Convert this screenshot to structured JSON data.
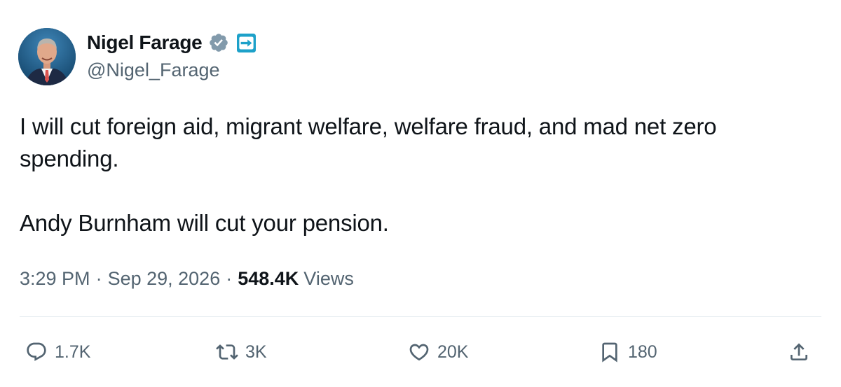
{
  "author": {
    "name": "Nigel Farage",
    "handle": "@Nigel_Farage",
    "verified_icon": "verified-badge-icon",
    "affiliation_icon": "affiliation-badge-icon",
    "verified_color": "#829aab",
    "affiliation_color": "#1da1c9"
  },
  "post": {
    "paragraphs": [
      "I will cut foreign aid, migrant welfare, welfare fraud, and mad net zero spending.",
      "Andy Burnham will cut your pension."
    ],
    "time": "3:29 PM",
    "separator": "·",
    "date": "Sep 29, 2026",
    "views_count": "548.4K",
    "views_label": "Views"
  },
  "actions": {
    "reply": {
      "icon": "reply-icon",
      "count": "1.7K"
    },
    "repost": {
      "icon": "repost-icon",
      "count": "3K"
    },
    "like": {
      "icon": "heart-icon",
      "count": "20K"
    },
    "bookmark": {
      "icon": "bookmark-icon",
      "count": "180"
    },
    "share": {
      "icon": "share-icon"
    }
  },
  "colors": {
    "text": "#0f1419",
    "secondary": "#536471",
    "divider": "#e6ecf0"
  }
}
